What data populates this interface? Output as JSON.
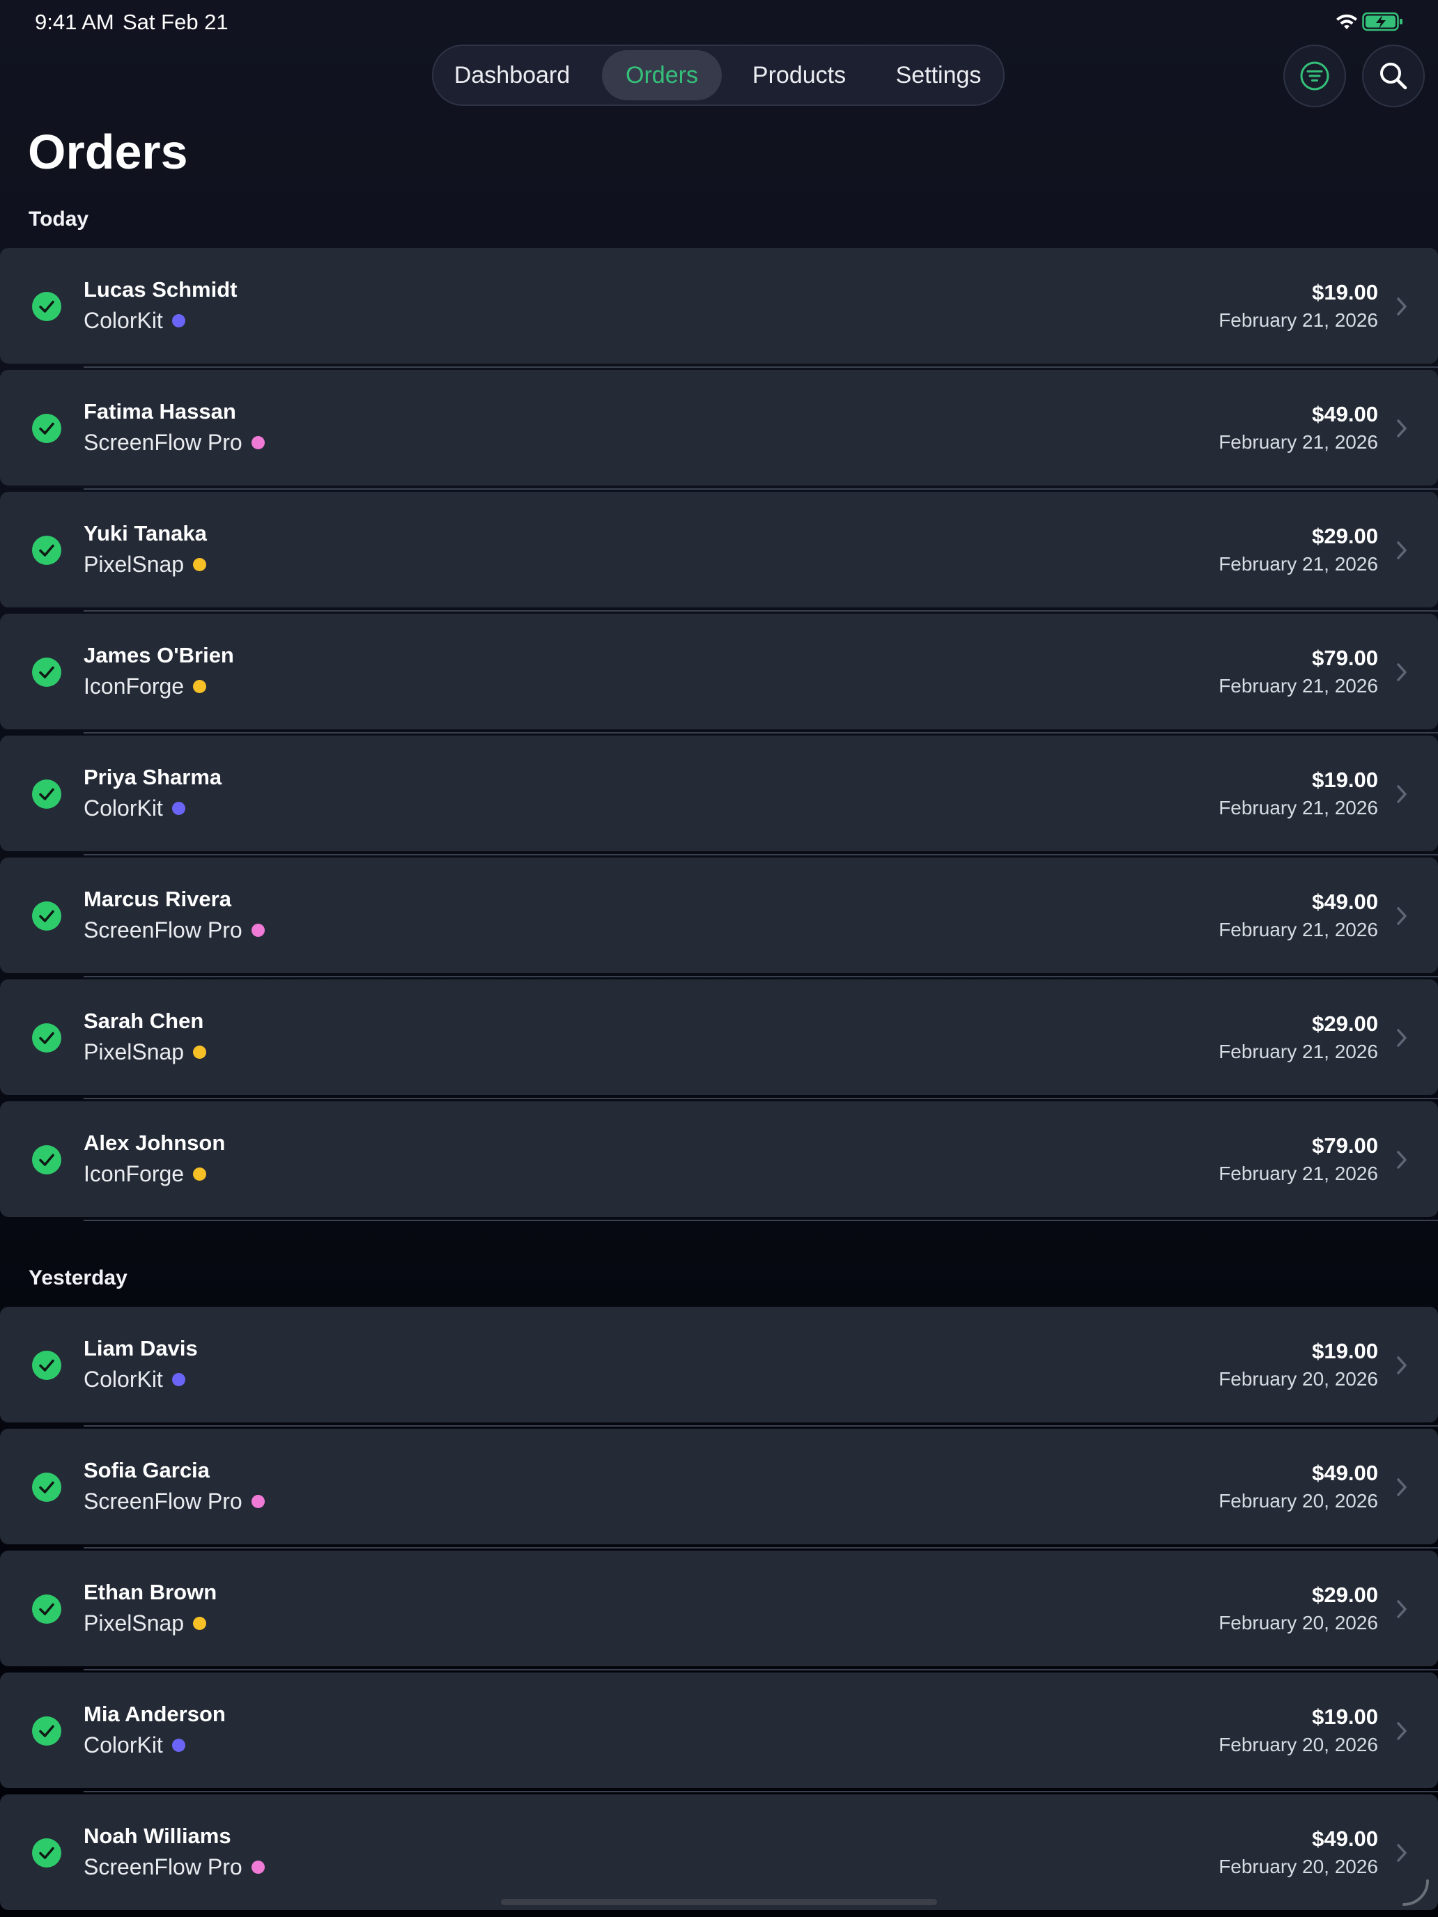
{
  "status_bar": {
    "time": "9:41 AM",
    "date": "Sat Feb 21"
  },
  "nav": {
    "tabs": [
      {
        "label": "Dashboard",
        "active": false
      },
      {
        "label": "Orders",
        "active": true
      },
      {
        "label": "Products",
        "active": false
      },
      {
        "label": "Settings",
        "active": false
      }
    ],
    "filter_icon": "filter-icon",
    "search_icon": "search-icon"
  },
  "page": {
    "title": "Orders"
  },
  "product_colors": {
    "ColorKit": "#6a65f6",
    "ScreenFlow Pro": "#f07bd7",
    "PixelSnap": "#f6c026",
    "IconForge": "#f6c026"
  },
  "accent_color": "#35c07a",
  "sections": [
    {
      "title": "Today",
      "orders": [
        {
          "customer": "Lucas Schmidt",
          "product": "ColorKit",
          "amount": "$19.00",
          "date": "February 21, 2026",
          "status": "completed"
        },
        {
          "customer": "Fatima Hassan",
          "product": "ScreenFlow Pro",
          "amount": "$49.00",
          "date": "February 21, 2026",
          "status": "completed"
        },
        {
          "customer": "Yuki Tanaka",
          "product": "PixelSnap",
          "amount": "$29.00",
          "date": "February 21, 2026",
          "status": "completed"
        },
        {
          "customer": "James O'Brien",
          "product": "IconForge",
          "amount": "$79.00",
          "date": "February 21, 2026",
          "status": "completed"
        },
        {
          "customer": "Priya Sharma",
          "product": "ColorKit",
          "amount": "$19.00",
          "date": "February 21, 2026",
          "status": "completed"
        },
        {
          "customer": "Marcus Rivera",
          "product": "ScreenFlow Pro",
          "amount": "$49.00",
          "date": "February 21, 2026",
          "status": "completed"
        },
        {
          "customer": "Sarah Chen",
          "product": "PixelSnap",
          "amount": "$29.00",
          "date": "February 21, 2026",
          "status": "completed"
        },
        {
          "customer": "Alex Johnson",
          "product": "IconForge",
          "amount": "$79.00",
          "date": "February 21, 2026",
          "status": "completed"
        }
      ]
    },
    {
      "title": "Yesterday",
      "orders": [
        {
          "customer": "Liam Davis",
          "product": "ColorKit",
          "amount": "$19.00",
          "date": "February 20, 2026",
          "status": "completed"
        },
        {
          "customer": "Sofia Garcia",
          "product": "ScreenFlow Pro",
          "amount": "$49.00",
          "date": "February 20, 2026",
          "status": "completed"
        },
        {
          "customer": "Ethan Brown",
          "product": "PixelSnap",
          "amount": "$29.00",
          "date": "February 20, 2026",
          "status": "completed"
        },
        {
          "customer": "Mia Anderson",
          "product": "ColorKit",
          "amount": "$19.00",
          "date": "February 20, 2026",
          "status": "completed"
        },
        {
          "customer": "Noah Williams",
          "product": "ScreenFlow Pro",
          "amount": "$49.00",
          "date": "February 20, 2026",
          "status": "completed"
        }
      ]
    }
  ]
}
